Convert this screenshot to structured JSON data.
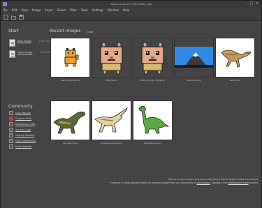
{
  "window": {
    "title": "Swimming cat.kra [* (Mod) RGB] - Krita",
    "controls": [
      "–",
      "□",
      "×"
    ]
  },
  "menu": [
    "File",
    "Edit",
    "View",
    "Image",
    "Layer",
    "Select",
    "Filter",
    "Tools",
    "Settings",
    "Window",
    "Help"
  ],
  "toolbar": {
    "icons": [
      "new-document-icon",
      "open-document-icon",
      "save-icon"
    ]
  },
  "start": {
    "title": "Start",
    "new_image": {
      "label": "New Image",
      "shortcut": "(Ctrl+N)"
    },
    "open_image": {
      "label": "Open Image",
      "shortcut": "(Ctrl+O)"
    }
  },
  "recent": {
    "title": "Recent Images",
    "clear": "Clear",
    "items": [
      {
        "caption": "Swimming cat.kra",
        "art": "orange-cat"
      },
      {
        "caption": "Kittycat.kra",
        "art": "cat-big"
      },
      {
        "caption": "Kittycat_Logo_Copy.kra",
        "art": "cat-big"
      },
      {
        "caption": "Mountain.kra",
        "art": "mountain"
      },
      {
        "caption": "raptor.kra",
        "art": "raptor"
      },
      {
        "caption": "Dinosaurs.kra",
        "art": "dino-dark"
      },
      {
        "caption": "Parasaurolophus.kra",
        "art": "dino-beige"
      },
      {
        "caption": "Brontosaurus.kra",
        "art": "dino-green"
      }
    ]
  },
  "community": {
    "title": "Community",
    "items": [
      "User Manual",
      "Support Krita",
      "Powered by KDE",
      "Source Code",
      "Getting Started",
      "User Community",
      "Krita Website"
    ]
  },
  "footer": {
    "line1": "Krita is an open source and community-driven tool for digital artists everywhere.",
    "line2_a": "Progress is made possible thanks to ongoing support from our community of ",
    "line2_link1": "contributors",
    "line2_b": ", sponsors, and ",
    "line2_link2": "development fund",
    "line2_c": " backers."
  }
}
